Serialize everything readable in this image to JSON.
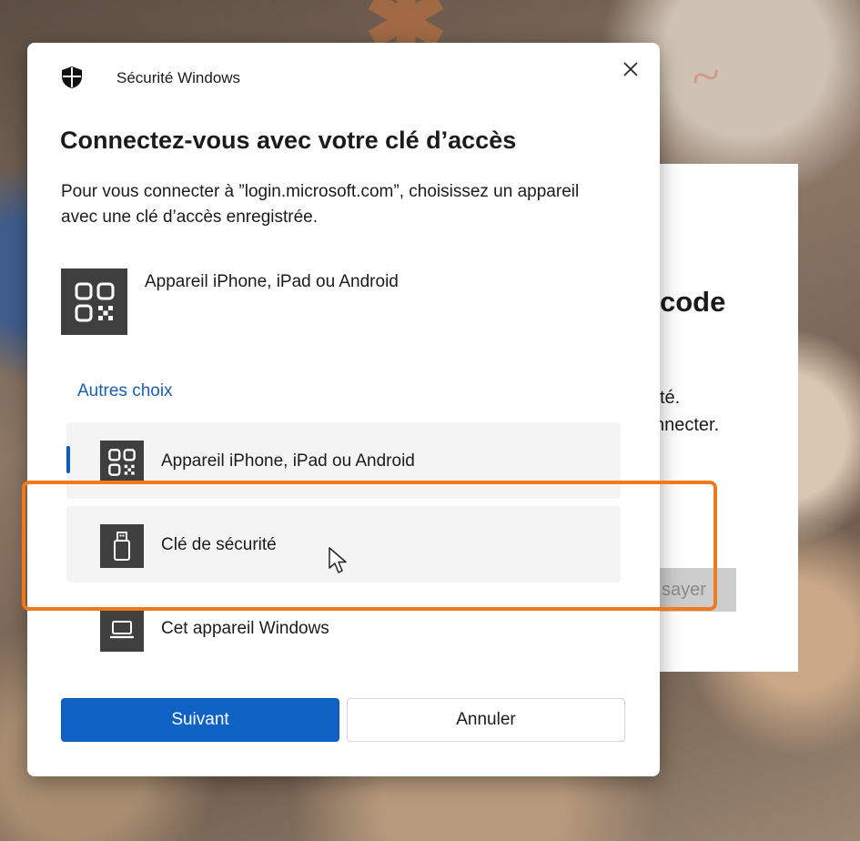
{
  "dialog": {
    "app_name": "Sécurité Windows",
    "title": "Connectez-vous avec votre clé d’accès",
    "description": "Pour vous connecter à ”login.microsoft.com”, choisissez un appareil avec une clé d’accès enregistrée.",
    "primary_option": {
      "label": "Appareil iPhone, iPad ou Android",
      "icon": "qr-code-icon"
    },
    "other_choices_label": "Autres choix",
    "options": [
      {
        "label": "Appareil iPhone, iPad ou Android",
        "icon": "qr-code-icon",
        "selected": true
      },
      {
        "label": "Clé de sécurité",
        "icon": "usb-key-icon",
        "selected": false
      },
      {
        "label": "Cet appareil Windows",
        "icon": "laptop-icon",
        "selected": false
      }
    ],
    "next_label": "Suivant",
    "cancel_label": "Annuler"
  },
  "background_page": {
    "heading_fragment": "code",
    "line1_fragment": "té.",
    "line2_fragment": "nnecter.",
    "button_fragment": "sayer"
  },
  "colors": {
    "accent": "#0f62c4",
    "highlight": "#f07a1a",
    "link": "#1a5fb4"
  }
}
